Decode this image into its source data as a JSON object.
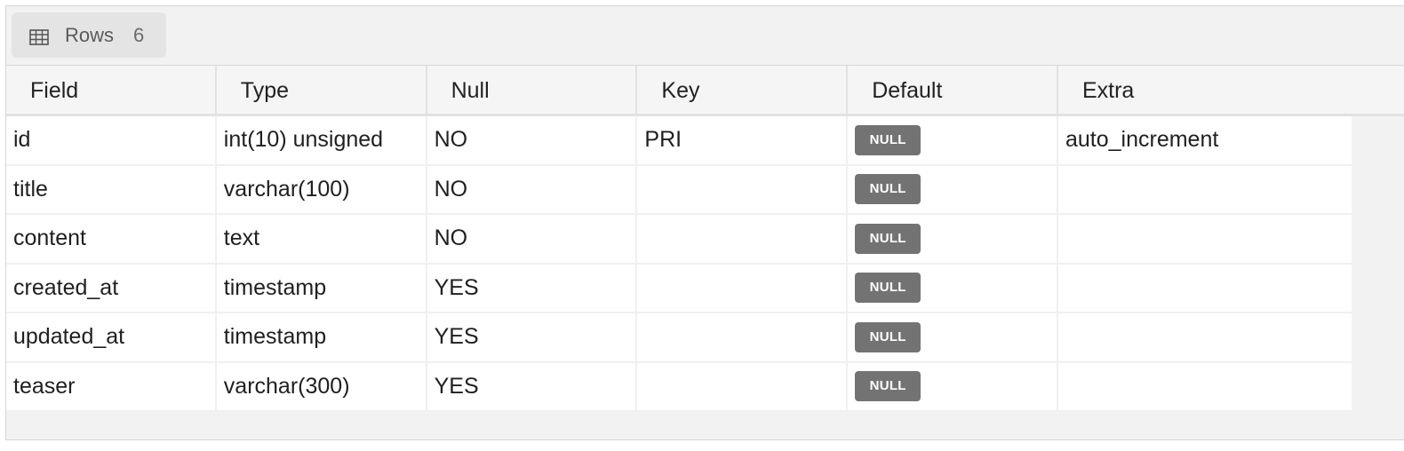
{
  "toolbar": {
    "tab_icon": "table-grid-icon",
    "tab_label": "Rows",
    "tab_count": "6"
  },
  "table": {
    "columns": [
      "Field",
      "Type",
      "Null",
      "Key",
      "Default",
      "Extra"
    ],
    "rows": [
      {
        "field": "id",
        "type": "int(10) unsigned",
        "null": "NO",
        "key": "PRI",
        "default": "NULL",
        "extra": "auto_increment"
      },
      {
        "field": "title",
        "type": "varchar(100)",
        "null": "NO",
        "key": "",
        "default": "NULL",
        "extra": ""
      },
      {
        "field": "content",
        "type": "text",
        "null": "NO",
        "key": "",
        "default": "NULL",
        "extra": ""
      },
      {
        "field": "created_at",
        "type": "timestamp",
        "null": "YES",
        "key": "",
        "default": "NULL",
        "extra": ""
      },
      {
        "field": "updated_at",
        "type": "timestamp",
        "null": "YES",
        "key": "",
        "default": "NULL",
        "extra": ""
      },
      {
        "field": "teaser",
        "type": "varchar(300)",
        "null": "YES",
        "key": "",
        "default": "NULL",
        "extra": ""
      }
    ]
  },
  "colors": {
    "panel_bg": "#f2f2f2",
    "null_badge": "#737373"
  }
}
